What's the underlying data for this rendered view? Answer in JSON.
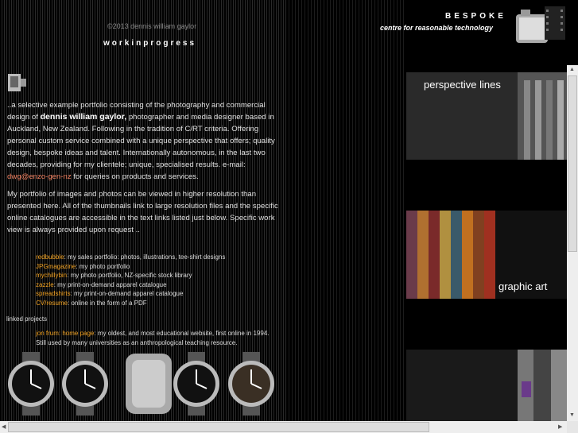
{
  "header": {
    "copyright": "©2013 dennis william gaylor",
    "subtitle": "workinprogress",
    "brand": "BESPOKE",
    "tagline": "centre for reasonable technology"
  },
  "intro": {
    "part1": "..a selective example portfolio consisting of the photography and commercial design of",
    "name": "dennis william gaylor,",
    "part2": "photographer and media designer based in Auckland, New Zealand. Following in the tradition of C/RT criteria. Offering personal custom service combined with a unique perspective that offers; quality design, bespoke ideas and talent. Internationally autonomous, in the last two decades, providing for my clientele; unique, specialised results. e-mail:",
    "email": "dwg@enzo-gen-nz",
    "part3": "for queries on products and services."
  },
  "portfolio_text": "My portfolio of images and photos can be viewed in higher resolution than presented here. All of the thumbnails link to large resolution files and the specific online catalogues are accessible in the text links listed just below. Specific work view is always provided upon request ..",
  "links": [
    {
      "name": "redbubble",
      "desc": ": my sales portfolio: photos, illustrations, tee-shirt designs"
    },
    {
      "name": "JPGmagazine",
      "desc": ": my photo portfolio"
    },
    {
      "name": "mychillybin",
      "desc": ": my photo portfolio, NZ-specific stock library"
    },
    {
      "name": "zazzle",
      "desc": ": my print-on-demand apparel catalogue"
    },
    {
      "name": "spreadshirts",
      "desc": ": my print-on-demand apparel catalogue"
    },
    {
      "name": "CV/resume",
      "desc": ": online in the form of a PDF"
    }
  ],
  "linked_projects": {
    "heading": "linked projects",
    "name": "jon frum: home page",
    "desc": ": my oldest, and most educational website, first online in 1994. Still used by many universities as an anthropological teaching resource."
  },
  "panels": {
    "perspective": "perspective lines",
    "graphic": "graphic art"
  },
  "colors": {
    "link_orange": "#f0a020",
    "email": "#f08060"
  }
}
